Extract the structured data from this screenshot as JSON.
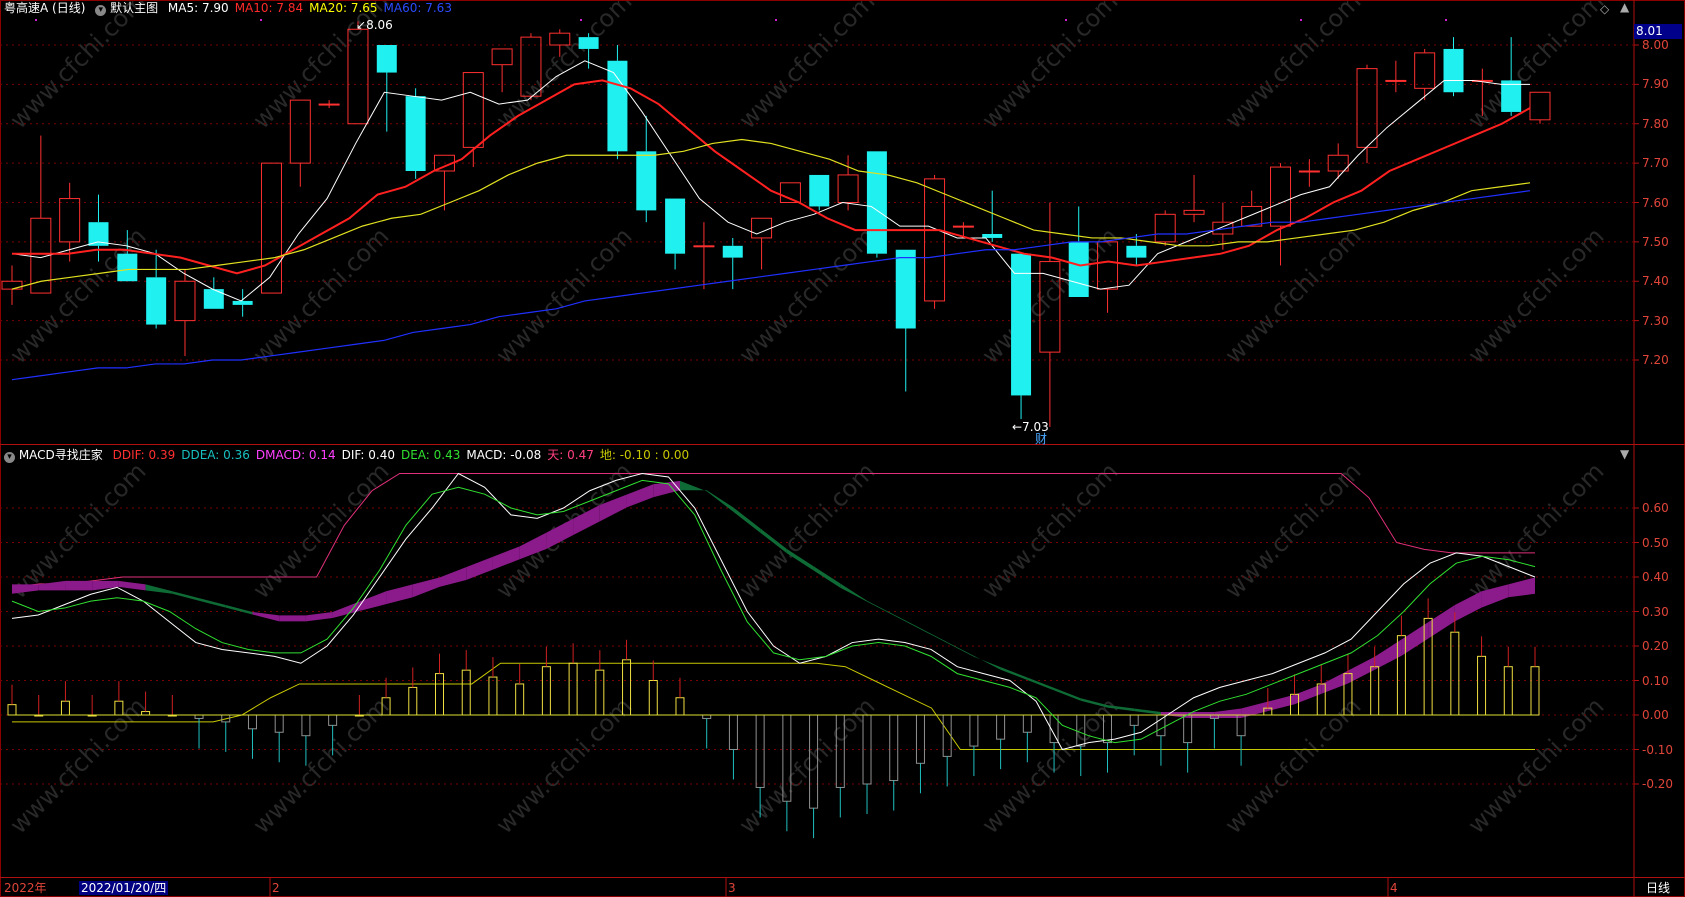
{
  "top_panel": {
    "stock_name": "粤高速A",
    "period": "(日线)",
    "menu_label": "默认主图",
    "legend": [
      {
        "label": "MA5: 7.90",
        "color": "#ffffff"
      },
      {
        "label": "MA10: 7.84",
        "color": "#ff2a2a"
      },
      {
        "label": "MA20: 7.65",
        "color": "#ffff00"
      },
      {
        "label": "MA60: 7.63",
        "color": "#2b4bff"
      }
    ],
    "last_price": "8.01",
    "high_marker": "8.06",
    "low_marker": "←7.03",
    "event_marker": "财",
    "y_ticks": [
      "8.00",
      "7.90",
      "7.80",
      "7.70",
      "7.60",
      "7.50",
      "7.40",
      "7.30",
      "7.20"
    ]
  },
  "bottom_panel": {
    "indicator_name": "MACD寻找庄家",
    "legend": [
      {
        "label": "DDIF: 0.39",
        "color": "#ff3030"
      },
      {
        "label": "DDEA: 0.36",
        "color": "#18c0c0"
      },
      {
        "label": "DMACD: 0.14",
        "color": "#ff40ff"
      },
      {
        "label": "DIF: 0.40",
        "color": "#ffffff"
      },
      {
        "label": "DEA: 0.43",
        "color": "#30e030"
      },
      {
        "label": "MACD: -0.08",
        "color": "#ffffff"
      },
      {
        "label": "天: 0.47",
        "color": "#ff4080"
      },
      {
        "label": "地: -0.10 : 0.00",
        "color": "#c8c800"
      }
    ],
    "y_ticks": [
      "0.60",
      "0.50",
      "0.40",
      "0.30",
      "0.20",
      "0.10",
      "0.00",
      "-0.10",
      "-0.20"
    ]
  },
  "x_axis": {
    "year_label": "2022年",
    "cursor_date": "2022/01/20/四",
    "month_labels": [
      "2",
      "3",
      "4"
    ],
    "period_label": "日线"
  },
  "watermark": "www.cfchi.com",
  "chart_data": [
    {
      "type": "candlestick",
      "title": "粤高速A (日线)",
      "ylim": [
        7.03,
        8.06
      ],
      "candles_ohlc": [
        [
          7.38,
          7.44,
          7.34,
          7.4
        ],
        [
          7.37,
          7.77,
          7.37,
          7.56
        ],
        [
          7.5,
          7.65,
          7.45,
          7.61
        ],
        [
          7.55,
          7.62,
          7.45,
          7.49
        ],
        [
          7.47,
          7.53,
          7.4,
          7.4
        ],
        [
          7.41,
          7.48,
          7.28,
          7.29
        ],
        [
          7.3,
          7.43,
          7.21,
          7.4
        ],
        [
          7.38,
          7.41,
          7.33,
          7.33
        ],
        [
          7.35,
          7.38,
          7.31,
          7.34
        ],
        [
          7.37,
          7.7,
          7.37,
          7.7
        ],
        [
          7.7,
          7.86,
          7.64,
          7.86
        ],
        [
          7.85,
          7.86,
          7.84,
          7.85
        ],
        [
          7.8,
          8.06,
          7.8,
          8.04
        ],
        [
          8.0,
          8.0,
          7.78,
          7.93
        ],
        [
          7.87,
          7.89,
          7.66,
          7.68
        ],
        [
          7.68,
          7.72,
          7.58,
          7.72
        ],
        [
          7.74,
          7.93,
          7.69,
          7.93
        ],
        [
          7.95,
          7.99,
          7.88,
          7.99
        ],
        [
          7.87,
          8.03,
          7.86,
          8.02
        ],
        [
          8.0,
          8.04,
          7.97,
          8.03
        ],
        [
          8.02,
          8.03,
          7.94,
          7.99
        ],
        [
          7.96,
          8.0,
          7.71,
          7.73
        ],
        [
          7.73,
          7.82,
          7.55,
          7.58
        ],
        [
          7.61,
          7.61,
          7.43,
          7.47
        ],
        [
          7.49,
          7.55,
          7.38,
          7.49
        ],
        [
          7.49,
          7.51,
          7.38,
          7.46
        ],
        [
          7.51,
          7.56,
          7.43,
          7.56
        ],
        [
          7.6,
          7.65,
          7.6,
          7.65
        ],
        [
          7.67,
          7.67,
          7.58,
          7.59
        ],
        [
          7.6,
          7.72,
          7.58,
          7.67
        ],
        [
          7.73,
          7.73,
          7.46,
          7.47
        ],
        [
          7.48,
          7.48,
          7.12,
          7.28
        ],
        [
          7.35,
          7.67,
          7.33,
          7.66
        ],
        [
          7.54,
          7.55,
          7.51,
          7.54
        ],
        [
          7.52,
          7.63,
          7.5,
          7.51
        ],
        [
          7.47,
          7.47,
          7.05,
          7.11
        ],
        [
          7.22,
          7.6,
          7.03,
          7.45
        ],
        [
          7.5,
          7.59,
          7.36,
          7.36
        ],
        [
          7.38,
          7.5,
          7.32,
          7.5
        ],
        [
          7.49,
          7.52,
          7.44,
          7.46
        ],
        [
          7.5,
          7.58,
          7.49,
          7.57
        ],
        [
          7.57,
          7.67,
          7.55,
          7.58
        ],
        [
          7.52,
          7.6,
          7.48,
          7.55
        ],
        [
          7.54,
          7.63,
          7.54,
          7.59
        ],
        [
          7.54,
          7.7,
          7.44,
          7.69
        ],
        [
          7.68,
          7.71,
          7.64,
          7.68
        ],
        [
          7.68,
          7.75,
          7.66,
          7.72
        ],
        [
          7.74,
          7.95,
          7.7,
          7.94
        ],
        [
          7.91,
          7.96,
          7.88,
          7.91
        ],
        [
          7.89,
          7.99,
          7.86,
          7.98
        ],
        [
          7.99,
          8.02,
          7.87,
          7.88
        ],
        [
          7.91,
          7.94,
          7.82,
          7.91
        ],
        [
          7.91,
          8.02,
          7.82,
          7.83
        ],
        [
          7.81,
          7.88,
          7.8,
          7.88
        ]
      ],
      "series": [
        {
          "name": "MA5",
          "values": [
            7.47,
            7.46,
            7.48,
            7.5,
            7.49,
            7.47,
            7.42,
            7.38,
            7.35,
            7.41,
            7.52,
            7.61,
            7.75,
            7.88,
            7.87,
            7.86,
            7.88,
            7.85,
            7.86,
            7.92,
            7.96,
            7.93,
            7.83,
            7.72,
            7.61,
            7.55,
            7.52,
            7.55,
            7.57,
            7.6,
            7.59,
            7.54,
            7.54,
            7.51,
            7.51,
            7.42,
            7.42,
            7.4,
            7.38,
            7.39,
            7.47,
            7.5,
            7.53,
            7.56,
            7.59,
            7.62,
            7.64,
            7.72,
            7.79,
            7.85,
            7.91,
            7.91,
            7.9,
            7.9
          ]
        },
        {
          "name": "MA10",
          "values": [
            7.47,
            7.47,
            7.47,
            7.48,
            7.48,
            7.47,
            7.46,
            7.44,
            7.42,
            7.44,
            7.48,
            7.52,
            7.56,
            7.62,
            7.64,
            7.68,
            7.71,
            7.77,
            7.82,
            7.86,
            7.9,
            7.91,
            7.89,
            7.85,
            7.79,
            7.73,
            7.68,
            7.63,
            7.6,
            7.56,
            7.53,
            7.53,
            7.53,
            7.53,
            7.51,
            7.49,
            7.47,
            7.46,
            7.44,
            7.45,
            7.44,
            7.45,
            7.46,
            7.47,
            7.49,
            7.53,
            7.56,
            7.6,
            7.63,
            7.68,
            7.71,
            7.74,
            7.77,
            7.8,
            7.84
          ]
        },
        {
          "name": "MA20",
          "values": [
            7.38,
            7.4,
            7.41,
            7.42,
            7.43,
            7.43,
            7.43,
            7.44,
            7.45,
            7.46,
            7.48,
            7.51,
            7.54,
            7.56,
            7.57,
            7.6,
            7.63,
            7.67,
            7.7,
            7.72,
            7.72,
            7.72,
            7.72,
            7.73,
            7.75,
            7.76,
            7.75,
            7.73,
            7.71,
            7.68,
            7.67,
            7.65,
            7.62,
            7.59,
            7.56,
            7.53,
            7.52,
            7.51,
            7.51,
            7.5,
            7.49,
            7.49,
            7.5,
            7.5,
            7.51,
            7.52,
            7.53,
            7.55,
            7.58,
            7.6,
            7.63,
            7.64,
            7.65
          ]
        },
        {
          "name": "MA60",
          "values": [
            7.15,
            7.16,
            7.17,
            7.18,
            7.18,
            7.19,
            7.19,
            7.2,
            7.2,
            7.21,
            7.22,
            7.23,
            7.24,
            7.25,
            7.27,
            7.28,
            7.29,
            7.31,
            7.32,
            7.33,
            7.35,
            7.36,
            7.37,
            7.38,
            7.39,
            7.4,
            7.41,
            7.42,
            7.43,
            7.44,
            7.45,
            7.46,
            7.46,
            7.47,
            7.48,
            7.48,
            7.49,
            7.5,
            7.5,
            7.51,
            7.52,
            7.52,
            7.53,
            7.54,
            7.55,
            7.55,
            7.56,
            7.57,
            7.58,
            7.59,
            7.6,
            7.61,
            7.62,
            7.63
          ]
        }
      ]
    },
    {
      "type": "line",
      "title": "MACD寻找庄家",
      "ylim": [
        -0.25,
        0.72
      ],
      "series": [
        {
          "name": "DIF",
          "values": [
            0.28,
            0.29,
            0.32,
            0.35,
            0.37,
            0.33,
            0.27,
            0.21,
            0.19,
            0.18,
            0.17,
            0.15,
            0.2,
            0.29,
            0.4,
            0.51,
            0.6,
            0.7,
            0.66,
            0.58,
            0.57,
            0.6,
            0.65,
            0.68,
            0.7,
            0.69,
            0.6,
            0.45,
            0.3,
            0.2,
            0.15,
            0.17,
            0.21,
            0.22,
            0.21,
            0.19,
            0.14,
            0.12,
            0.1,
            0.04,
            -0.1,
            -0.08,
            -0.07,
            -0.05,
            0.0,
            0.05,
            0.08,
            0.1,
            0.12,
            0.15,
            0.18,
            0.22,
            0.3,
            0.38,
            0.44,
            0.47,
            0.46,
            0.43,
            0.4
          ]
        },
        {
          "name": "DEA",
          "values": [
            0.33,
            0.3,
            0.31,
            0.33,
            0.34,
            0.33,
            0.3,
            0.25,
            0.21,
            0.19,
            0.18,
            0.18,
            0.22,
            0.31,
            0.42,
            0.55,
            0.64,
            0.66,
            0.64,
            0.6,
            0.58,
            0.59,
            0.62,
            0.65,
            0.68,
            0.67,
            0.58,
            0.42,
            0.27,
            0.18,
            0.16,
            0.17,
            0.2,
            0.21,
            0.2,
            0.17,
            0.12,
            0.1,
            0.08,
            0.05,
            -0.03,
            -0.06,
            -0.08,
            -0.07,
            -0.03,
            0.01,
            0.04,
            0.06,
            0.09,
            0.12,
            0.15,
            0.18,
            0.23,
            0.3,
            0.38,
            0.44,
            0.46,
            0.45,
            0.43
          ]
        },
        {
          "name": "DDIF",
          "values": [
            0.37,
            0.37,
            0.38,
            0.38,
            0.38,
            0.37,
            0.35,
            0.33,
            0.31,
            0.29,
            0.28,
            0.28,
            0.29,
            0.32,
            0.35,
            0.37,
            0.39,
            0.42,
            0.45,
            0.48,
            0.52,
            0.56,
            0.6,
            0.63,
            0.66,
            0.67,
            0.64,
            0.58,
            0.52,
            0.46,
            0.41,
            0.36,
            0.32,
            0.28,
            0.24,
            0.2,
            0.16,
            0.13,
            0.1,
            0.07,
            0.04,
            0.02,
            0.01,
            0.0,
            0.0,
            0.0,
            0.01,
            0.03,
            0.05,
            0.08,
            0.12,
            0.16,
            0.21,
            0.26,
            0.31,
            0.35,
            0.37,
            0.39
          ]
        },
        {
          "name": "DDEA",
          "values": [
            0.36,
            0.37,
            0.37,
            0.37,
            0.38,
            0.37,
            0.36,
            0.34,
            0.32,
            0.3,
            0.28,
            0.28,
            0.29,
            0.31,
            0.33,
            0.35,
            0.38,
            0.4,
            0.43,
            0.46,
            0.49,
            0.53,
            0.57,
            0.61,
            0.64,
            0.66,
            0.66,
            0.61,
            0.55,
            0.49,
            0.44,
            0.39,
            0.34,
            0.3,
            0.26,
            0.22,
            0.18,
            0.14,
            0.11,
            0.08,
            0.05,
            0.03,
            0.02,
            0.01,
            0.0,
            0.0,
            0.0,
            0.02,
            0.04,
            0.07,
            0.1,
            0.14,
            0.18,
            0.23,
            0.28,
            0.32,
            0.35,
            0.36
          ]
        },
        {
          "name": "天",
          "values": [
            0.37,
            0.38,
            0.38,
            0.39,
            0.4,
            0.4,
            0.4,
            0.4,
            0.4,
            0.4,
            0.4,
            0.4,
            0.55,
            0.65,
            0.7,
            0.7,
            0.7,
            0.7,
            0.7,
            0.7,
            0.7,
            0.7,
            0.7,
            0.7,
            0.7,
            0.7,
            0.7,
            0.7,
            0.7,
            0.7,
            0.7,
            0.7,
            0.7,
            0.7,
            0.7,
            0.7,
            0.7,
            0.7,
            0.7,
            0.7,
            0.7,
            0.7,
            0.7,
            0.7,
            0.7,
            0.7,
            0.7,
            0.7,
            0.7,
            0.63,
            0.5,
            0.48,
            0.47,
            0.47,
            0.47,
            0.47
          ]
        },
        {
          "name": "地",
          "values": [
            -0.02,
            -0.02,
            -0.02,
            -0.02,
            -0.02,
            -0.02,
            -0.02,
            -0.02,
            0.0,
            0.05,
            0.09,
            0.09,
            0.09,
            0.09,
            0.09,
            0.09,
            0.09,
            0.15,
            0.15,
            0.15,
            0.15,
            0.15,
            0.15,
            0.15,
            0.15,
            0.15,
            0.15,
            0.15,
            0.15,
            0.14,
            0.1,
            0.06,
            0.02,
            -0.1,
            -0.1,
            -0.1,
            -0.1,
            -0.1,
            -0.1,
            -0.1,
            -0.1,
            -0.1,
            -0.1,
            -0.1,
            -0.1,
            -0.1,
            -0.1,
            -0.1,
            -0.1,
            -0.1,
            -0.1,
            -0.1,
            -0.1,
            -0.1
          ]
        },
        {
          "name": "MACD",
          "values": [
            0.03,
            0.0,
            0.04,
            0.0,
            0.04,
            0.01,
            0.0,
            -0.01,
            -0.02,
            -0.04,
            -0.05,
            -0.06,
            -0.03,
            0.0,
            0.05,
            0.08,
            0.12,
            0.13,
            0.11,
            0.09,
            0.14,
            0.15,
            0.13,
            0.16,
            0.1,
            0.05,
            -0.01,
            -0.1,
            -0.21,
            -0.25,
            -0.27,
            -0.21,
            -0.2,
            -0.19,
            -0.14,
            -0.12,
            -0.09,
            -0.07,
            -0.05,
            -0.08,
            -0.09,
            -0.08,
            -0.03,
            -0.06,
            -0.08,
            -0.01,
            -0.06,
            0.02,
            0.06,
            0.09,
            0.12,
            0.14,
            0.23,
            0.28,
            0.24,
            0.17,
            0.14,
            0.14
          ]
        }
      ]
    }
  ]
}
